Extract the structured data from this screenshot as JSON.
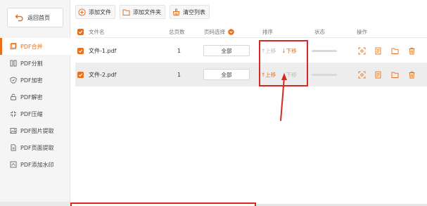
{
  "sidebar": {
    "back_label": "返回首页",
    "items": [
      {
        "label": "PDF合并",
        "icon": "merge-icon",
        "active": true
      },
      {
        "label": "PDF分割",
        "icon": "split-icon",
        "active": false
      },
      {
        "label": "PDF加密",
        "icon": "shield-icon",
        "active": false
      },
      {
        "label": "PDF解密",
        "icon": "unlock-icon",
        "active": false
      },
      {
        "label": "PDF压缩",
        "icon": "compress-icon",
        "active": false
      },
      {
        "label": "PDF图片提取",
        "icon": "image-icon",
        "active": false
      },
      {
        "label": "PDF页面提取",
        "icon": "page-icon",
        "active": false
      },
      {
        "label": "PDF添加水印",
        "icon": "watermark-icon",
        "active": false
      }
    ]
  },
  "toolbar": {
    "add_file": "添加文件",
    "add_folder": "添加文件夹",
    "clear_list": "清空列表"
  },
  "table": {
    "headers": {
      "filename": "文件名",
      "pages": "总页数",
      "page_select": "页码选择",
      "sort": "排序",
      "status": "状态",
      "actions": "操作"
    },
    "rows": [
      {
        "filename": "文件-1.pdf",
        "pages": "1",
        "page_select": "全部",
        "up": "上移",
        "down": "下移",
        "up_enabled": false,
        "down_enabled": true
      },
      {
        "filename": "文件-2.pdf",
        "pages": "1",
        "page_select": "全部",
        "up": "上移",
        "down": "下移",
        "up_enabled": true,
        "down_enabled": false
      }
    ]
  },
  "colors": {
    "accent": "#e8701a",
    "annotation": "#d8281f"
  }
}
